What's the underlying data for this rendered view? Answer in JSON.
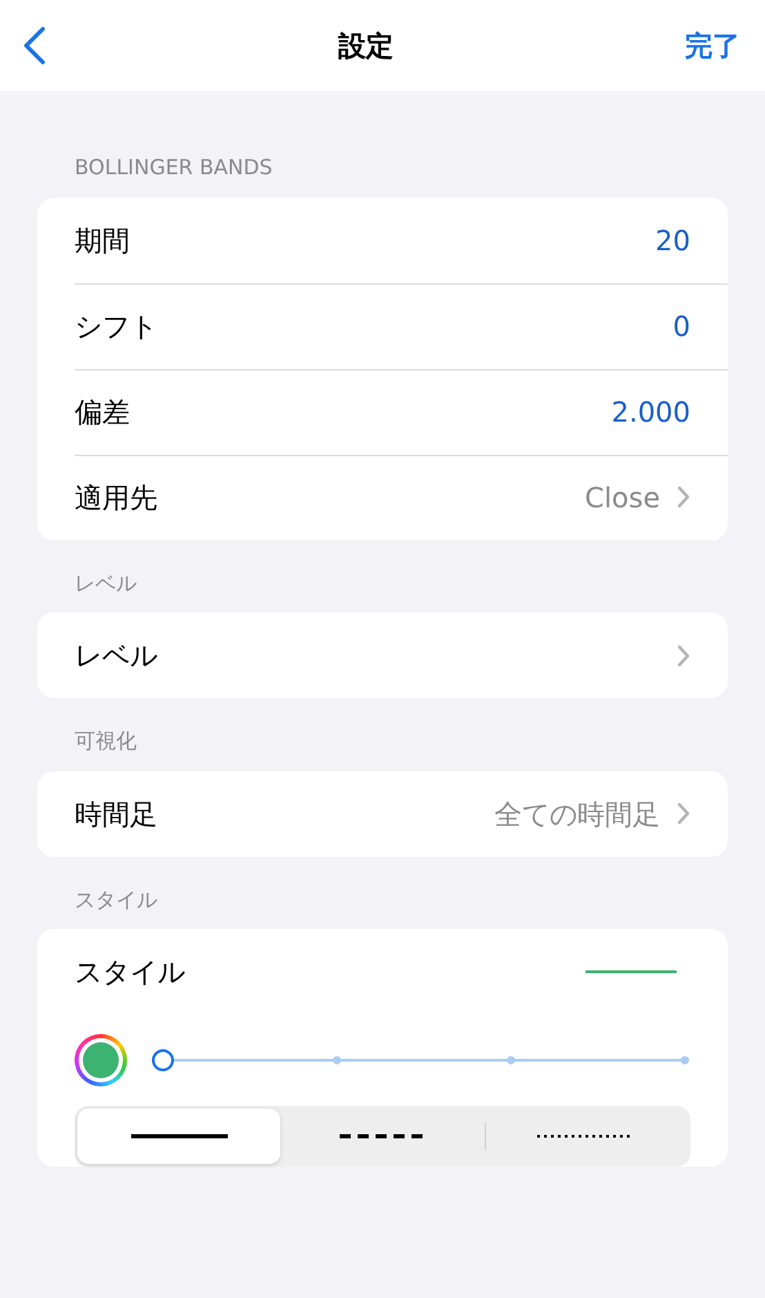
{
  "nav": {
    "title": "設定",
    "done": "完了"
  },
  "sections": [
    {
      "header": "BOLLINGER BANDS",
      "rows": [
        {
          "kind": "value",
          "label": "期間",
          "value": "20"
        },
        {
          "kind": "value",
          "label": "シフト",
          "value": "0"
        },
        {
          "kind": "value",
          "label": "偏差",
          "value": "2.000"
        },
        {
          "kind": "link",
          "label": "適用先",
          "value": "Close"
        }
      ]
    },
    {
      "header": "レベル",
      "rows": [
        {
          "kind": "link",
          "label": "レベル"
        }
      ]
    },
    {
      "header": "可視化",
      "rows": [
        {
          "kind": "link",
          "label": "時間足",
          "value": "全ての時間足"
        }
      ]
    },
    {
      "header": "スタイル",
      "rows": [
        {
          "kind": "style",
          "label": "スタイル",
          "color": "#3cb371",
          "level": 0,
          "line_styles": [
            {
              "kind": "solid",
              "selected": true
            },
            {
              "kind": "dashed",
              "selected": false
            },
            {
              "kind": "dotted",
              "selected": false
            }
          ]
        }
      ]
    }
  ]
}
